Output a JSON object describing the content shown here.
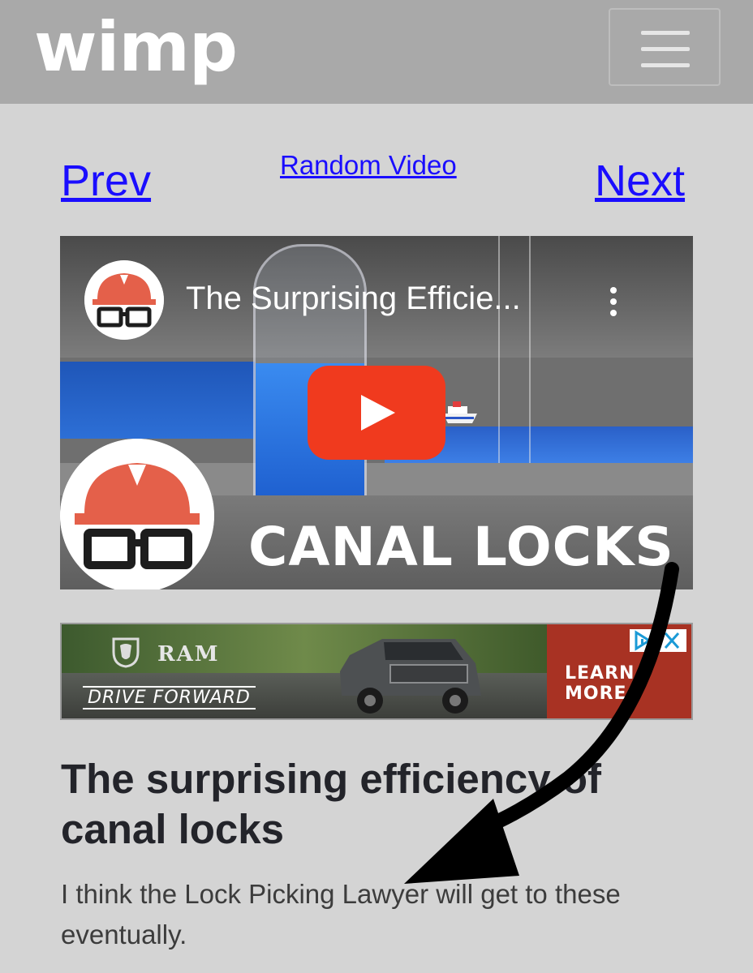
{
  "header": {
    "logo_text": "wimp",
    "menu_icon": "hamburger-menu-icon"
  },
  "nav": {
    "prev_label": "Prev",
    "random_label": "Random Video",
    "next_label": "Next"
  },
  "video": {
    "title": "The Surprising Efficie...",
    "thumbnail_caption": "CANAL LOCKS",
    "play_icon": "play-icon",
    "more_icon": "more-vertical-icon",
    "channel_icon": "hard-hat-glasses-avatar-icon",
    "play_color": "#f03a1e"
  },
  "ad": {
    "brand": "RAM",
    "tagline": "DRIVE FORWARD",
    "cta": "LEARN MORE",
    "adchoices_icon": "adchoices-icon",
    "close_icon": "close-icon",
    "cta_color": "#a83223"
  },
  "article": {
    "headline": "The surprising efficiency of canal locks",
    "description": "I think the Lock Picking Lawyer will get to these eventually."
  },
  "overlay": {
    "arrow_icon": "curved-arrow-annotation-icon"
  }
}
